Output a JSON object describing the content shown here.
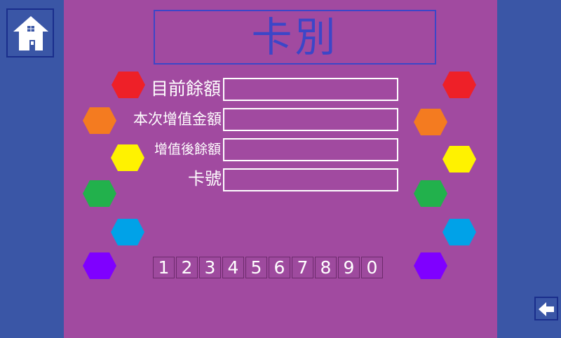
{
  "title": "卡別",
  "fields": [
    {
      "label": "目前餘額",
      "value": ""
    },
    {
      "label": "本次增值金額",
      "value": ""
    },
    {
      "label": "增值後餘額",
      "value": ""
    },
    {
      "label": "卡號",
      "value": ""
    }
  ],
  "keypad": [
    "1",
    "2",
    "3",
    "4",
    "5",
    "6",
    "7",
    "8",
    "9",
    "0"
  ],
  "nav": {
    "home_icon": "home-icon",
    "back_icon": "back-arrow-icon"
  },
  "colors": {
    "side": "#3a56a6",
    "main": "#a14aa0",
    "title": "#3c46c8",
    "hexagons": [
      "#ee2028",
      "#f47b20",
      "#fff200",
      "#22b14c",
      "#00a2e8",
      "#7f00ff"
    ]
  }
}
